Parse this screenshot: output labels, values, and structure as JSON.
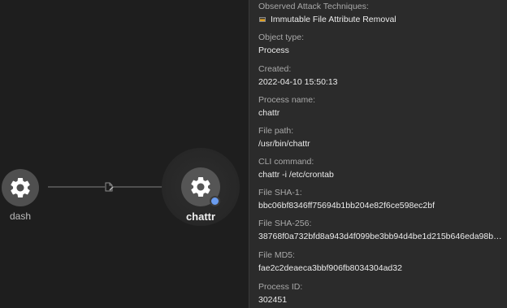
{
  "graph": {
    "nodes": [
      {
        "id": "dash",
        "label": "dash",
        "icon": "gear-icon"
      },
      {
        "id": "chattr",
        "label": "chattr",
        "icon": "gear-icon",
        "selected": true,
        "status_color": "#6a9cf0"
      }
    ],
    "edge": {
      "from": "dash",
      "to": "chattr",
      "icon": "file-edit-icon"
    }
  },
  "details": {
    "attack_techniques": {
      "label": "Observed Attack Techniques:",
      "items": [
        "Immutable File Attribute Removal"
      ]
    },
    "object_type": {
      "label": "Object type:",
      "value": "Process"
    },
    "created": {
      "label": "Created:",
      "value": "2022-04-10 15:50:13"
    },
    "process_name": {
      "label": "Process name:",
      "value": "chattr"
    },
    "file_path": {
      "label": "File path:",
      "value": "/usr/bin/chattr"
    },
    "cli_command": {
      "label": "CLI command:",
      "value": "chattr -i /etc/crontab"
    },
    "sha1": {
      "label": "File SHA-1:",
      "value": "bbc06bf8346ff75694b1bb204e82f6ce598ec2bf"
    },
    "sha256": {
      "label": "File SHA-256:",
      "value": "38768f0a732bfd8a943d4f099be3bb94d4be1d215b646eda98b95eb489..."
    },
    "md5": {
      "label": "File MD5:",
      "value": "fae2c2deaeca3bbf906fb8034304ad32"
    },
    "process_id": {
      "label": "Process ID:",
      "value": "302451"
    }
  }
}
